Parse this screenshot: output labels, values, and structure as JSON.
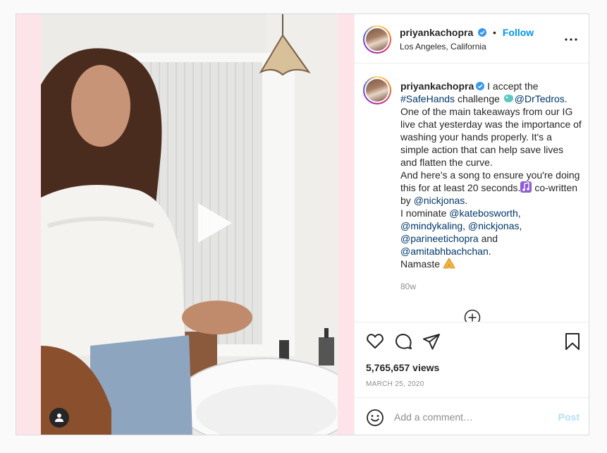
{
  "post": {
    "username": "priyankachopra",
    "verified": true,
    "follow_label": "Follow",
    "dot": "•",
    "location": "Los Angeles, California",
    "more_icon": "more-horizontal-icon",
    "caption": {
      "text_1": " I accept the ",
      "hashtag": "#SafeHands",
      "text_2": " challenge ",
      "mention_1": "@DrTedros",
      "text_3": ". One of the main takeaways from our IG live chat yesterday was the importance of washing your hands properly. It's a simple action that can help save lives and flatten the curve.",
      "text_4": "And here's a song to ensure you're doing this for at least 20 seconds.",
      "text_5": " co-written by ",
      "mention_2": "@nickjonas",
      "text_6": ".",
      "text_7": "I nominate ",
      "mention_3": "@katebosworth",
      "text_8": ",",
      "mention_4": "@mindykaling",
      "text_9": ", ",
      "mention_5": "@nickjonas",
      "text_10": ",",
      "mention_6": "@parineetichopra",
      "text_11": " and",
      "mention_7": "@amitabhbachchan",
      "text_12": ".",
      "text_13": "Namaste "
    },
    "time_ago": "80w",
    "views": "5,765,657 views",
    "date": "MARCH 25, 2020",
    "comment_placeholder": "Add a comment…",
    "post_label": "Post"
  },
  "icons": {
    "like": "heart-icon",
    "comment": "comment-icon",
    "share": "share-icon",
    "save": "bookmark-icon",
    "emoji": "smiley-icon",
    "load_more": "plus-circle-icon",
    "play": "play-icon",
    "tagged_user": "user-icon",
    "mute": "muted-speaker-icon"
  },
  "colors": {
    "link": "#00376b",
    "follow": "#0095f6",
    "verified": "#3897f0",
    "muted_text": "#8e8e8e",
    "post_disabled": "#b2dffc",
    "media_bg": "#fde4e8"
  }
}
